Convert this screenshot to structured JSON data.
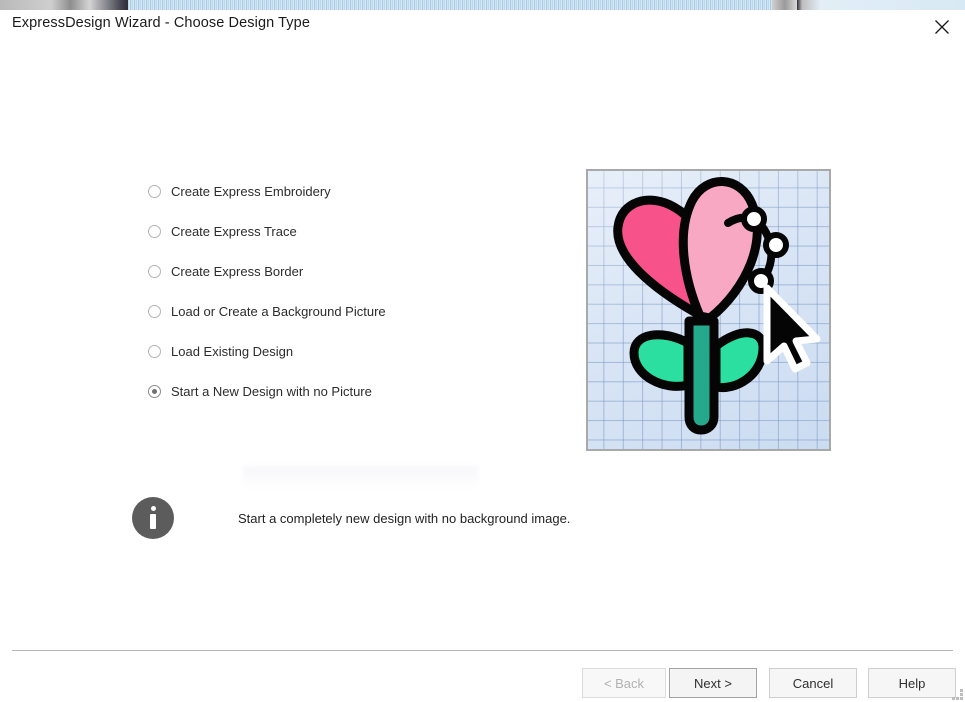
{
  "window": {
    "title": "ExpressDesign Wizard - Choose Design Type",
    "close_icon": "close-icon"
  },
  "options": {
    "items": [
      {
        "label": "Create Express Embroidery",
        "selected": false
      },
      {
        "label": "Create Express Trace",
        "selected": false
      },
      {
        "label": "Create Express Border",
        "selected": false
      },
      {
        "label": "Load or Create a Background Picture",
        "selected": false
      },
      {
        "label": "Load Existing Design",
        "selected": false
      },
      {
        "label": "Start a New Design with no Picture",
        "selected": true
      }
    ]
  },
  "preview": {
    "alt": "flower-on-grid-illustration",
    "colors": {
      "grid_background": "#d7e4f5",
      "grid_line": "#6e8cb9",
      "frame_border": "#a9a9a9",
      "petal_light": "#f9a8c3",
      "petal_dark": "#f7538a",
      "leaf": "#2bdfa0",
      "stem": "#25a98c",
      "outline": "#000000",
      "node_fill": "#ffffff",
      "cursor_fill": "#000000",
      "cursor_stroke": "#ffffff"
    }
  },
  "info": {
    "icon": "info-icon",
    "text": "Start a completely new design with no background image."
  },
  "footer": {
    "buttons": [
      {
        "label": "< Back",
        "state": "disabled"
      },
      {
        "label": "Next >",
        "state": "default"
      },
      {
        "label": "Cancel",
        "state": "normal"
      },
      {
        "label": "Help",
        "state": "normal"
      }
    ]
  }
}
